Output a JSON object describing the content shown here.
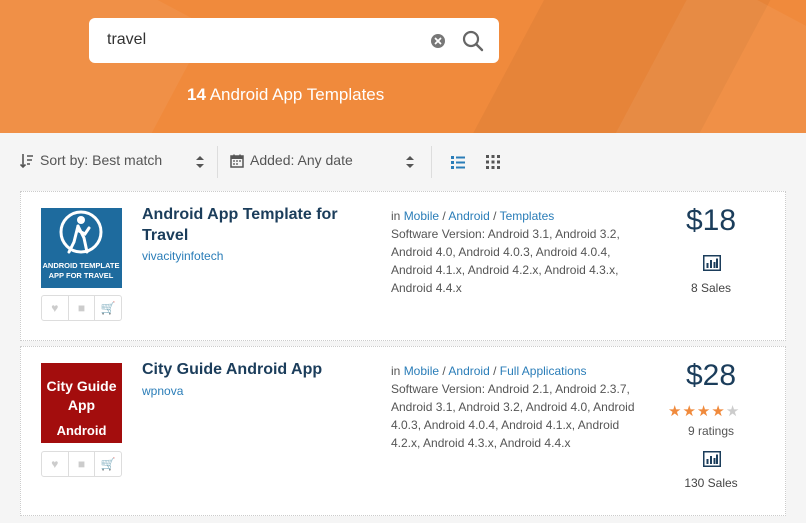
{
  "search": {
    "value": "travel",
    "placeholder": ""
  },
  "results": {
    "count": "14",
    "label": "Android App Templates"
  },
  "sort": {
    "sort_label": "Sort by: Best match",
    "added_label": "Added: Any date"
  },
  "colors": {
    "header": "#f08a3c",
    "accent": "#2a7db8",
    "title": "#1b3d5b",
    "star": "#f08a3c"
  },
  "items": [
    {
      "title_line1": "Android App Template for",
      "title_line2": "Travel",
      "author": "vivacityinfotech",
      "thumb_text_1": "ANDROID TEMPLATE",
      "thumb_text_2": "APP FOR TRAVEL",
      "in_label": "in",
      "cat1": "Mobile",
      "cat2": "Android",
      "cat3": "Templates",
      "version_lines": [
        "Software Version: Android 3.1, Android 3.2,",
        "Android 4.0, Android 4.0.3, Android 4.0.4,",
        "Android 4.1.x, Android 4.2.x, Android 4.3.x,",
        "Android 4.4.x"
      ],
      "price": "$18",
      "sales": "8 Sales"
    },
    {
      "title_line1": "City Guide Android App",
      "author": "wpnova",
      "thumb_text_1": "City Guide",
      "thumb_text_2": "App",
      "thumb_text_3": "Android",
      "in_label": "in",
      "cat1": "Mobile",
      "cat2": "Android",
      "cat3": "Full Applications",
      "version_lines": [
        "Software Version: Android 2.1, Android 2.3.7,",
        "Android 3.1, Android 3.2, Android 4.0, Android",
        "4.0.3, Android 4.0.4, Android 4.1.x, Android",
        "4.2.x, Android 4.3.x, Android 4.4.x"
      ],
      "price": "$28",
      "rating": 4,
      "ratings": "9 ratings",
      "sales": "130 Sales"
    }
  ]
}
